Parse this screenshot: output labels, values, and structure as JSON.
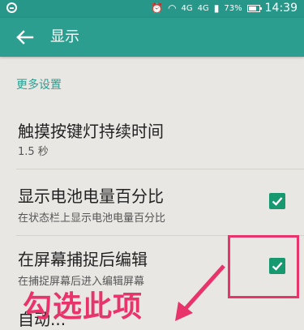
{
  "status_bar": {
    "network": "4G",
    "network_sub": "4G",
    "battery": "73%",
    "time": "14:39"
  },
  "app_bar": {
    "title": "显示"
  },
  "section": {
    "header": "更多设置"
  },
  "prefs": [
    {
      "title": "触摸按键灯持续时间",
      "summary": "1.5 秒"
    },
    {
      "title": "显示电池电量百分比",
      "summary": "在状态栏上显示电池电量百分比",
      "checked": true
    },
    {
      "title": "在屏幕捕捉后编辑",
      "summary": "在捕捉屏幕后进入编辑屏幕",
      "checked": true
    },
    {
      "title": "自动..."
    }
  ],
  "annotation": {
    "text": "勾选此项",
    "color": "#e8336b"
  },
  "colors": {
    "accent": "#2b9e90",
    "checkbox": "#16996e"
  }
}
